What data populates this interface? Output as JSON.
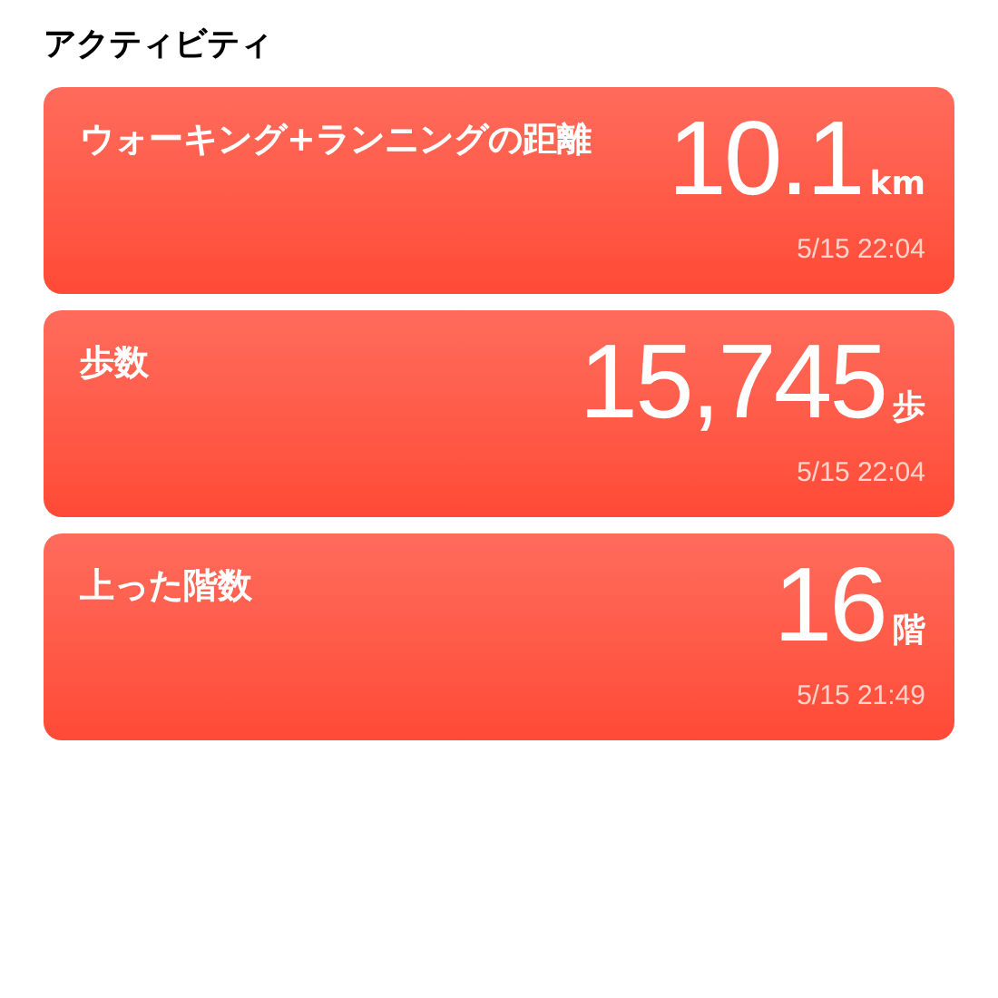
{
  "section_title": "アクティビティ",
  "cards": [
    {
      "title": "ウォーキング+ランニングの距離",
      "value": "10.1",
      "unit": "km",
      "time": "5/15 22:04"
    },
    {
      "title": "歩数",
      "value": "15,745",
      "unit": "歩",
      "time": "5/15 22:04"
    },
    {
      "title": "上った階数",
      "value": "16",
      "unit": "階",
      "time": "5/15 21:49"
    }
  ]
}
